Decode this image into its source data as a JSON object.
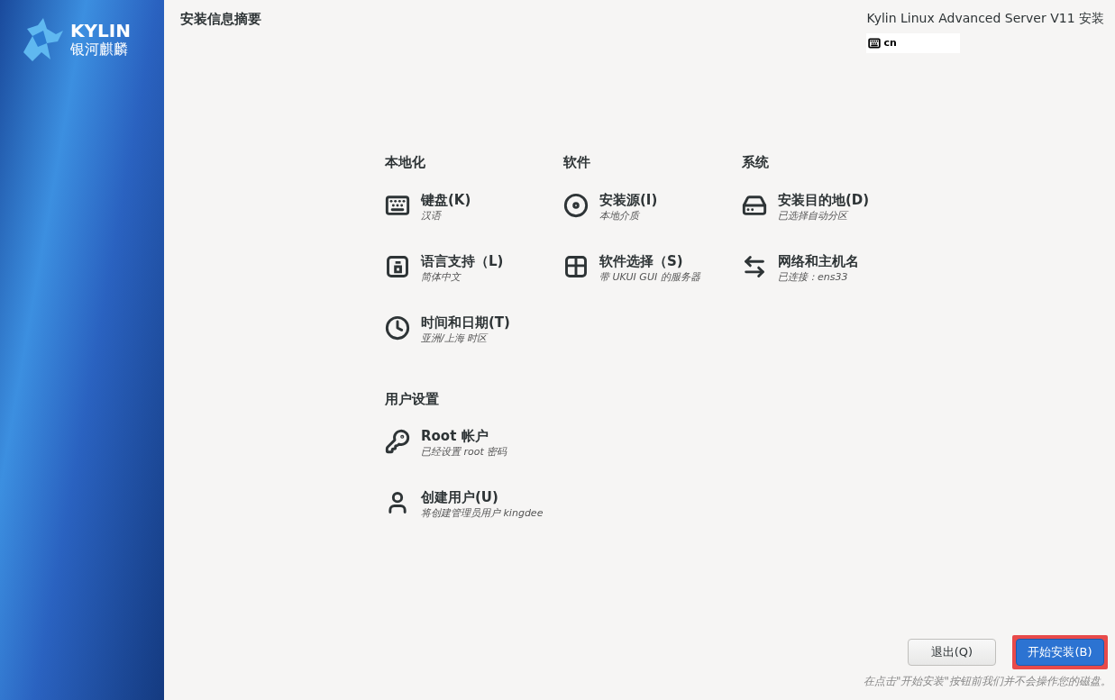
{
  "logo": {
    "name": "KYLIN",
    "subtitle": "银河麒麟"
  },
  "title": "安装信息摘要",
  "product": "Kylin Linux Advanced Server V11 安装",
  "keyboard_layout": "cn",
  "sections": [
    {
      "heading": "本地化",
      "items": [
        {
          "kind": "keyboard",
          "label": "键盘(K)",
          "status": "汉语"
        },
        {
          "kind": "language",
          "label": "语言支持（L)",
          "status": "简体中文"
        },
        {
          "kind": "clock",
          "label": "时间和日期(T)",
          "status": "亚洲/上海 时区"
        }
      ]
    },
    {
      "heading": "软件",
      "items": [
        {
          "kind": "disc",
          "label": "安装源(I)",
          "status": "本地介质"
        },
        {
          "kind": "package",
          "label": "软件选择（S)",
          "status": "带 UKUI GUI 的服务器"
        }
      ]
    },
    {
      "heading": "系统",
      "items": [
        {
          "kind": "drive",
          "label": "安装目的地(D)",
          "status": "已选择自动分区"
        },
        {
          "kind": "network",
          "label": "网络和主机名",
          "status": "已连接：ens33"
        }
      ]
    },
    {
      "heading": "用户设置",
      "items": [
        {
          "kind": "key",
          "label": "Root 帐户",
          "status": "已经设置 root 密码"
        },
        {
          "kind": "user",
          "label": "创建用户(U)",
          "status": "将创建管理员用户 kingdee"
        }
      ]
    }
  ],
  "buttons": [
    {
      "label": "退出(Q)",
      "kind": "secondary",
      "highlighted": false
    },
    {
      "label": "开始安装(B)",
      "kind": "primary",
      "highlighted": true
    }
  ],
  "note": "在点击\"开始安装\"按钮前我们并不会操作您的磁盘。"
}
